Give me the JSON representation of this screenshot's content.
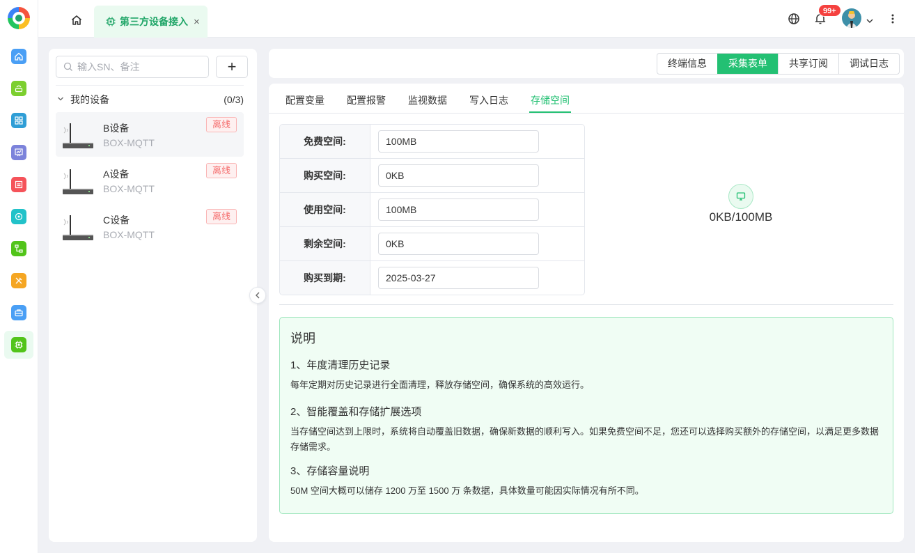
{
  "header": {
    "tab_label": "第三方设备接入",
    "tab_close": "×",
    "notification_count": "99+"
  },
  "sidebar": {
    "items": [
      {
        "icon": "home-icon",
        "color": "#4a9ff5"
      },
      {
        "icon": "cloud-device-icon",
        "color": "#7ccf2f"
      },
      {
        "icon": "apps-grid-icon",
        "color": "#2f9ed6"
      },
      {
        "icon": "chart-board-icon",
        "color": "#7c83db"
      },
      {
        "icon": "report-icon",
        "color": "#f5535a"
      },
      {
        "icon": "connect-icon",
        "color": "#22c2c9"
      },
      {
        "icon": "flow-icon",
        "color": "#52c41a"
      },
      {
        "icon": "tools-icon",
        "color": "#f5a623"
      },
      {
        "icon": "briefcase-icon",
        "color": "#4a9ff5"
      },
      {
        "icon": "chip-icon",
        "color": "#52c41a",
        "active": true
      }
    ]
  },
  "devices": {
    "search_placeholder": "输入SN、备注",
    "add_label": "+",
    "group_name": "我的设备",
    "group_count": "(0/3)",
    "items": [
      {
        "name": "B设备",
        "type": "BOX-MQTT",
        "status": "离线"
      },
      {
        "name": "A设备",
        "type": "BOX-MQTT",
        "status": "离线"
      },
      {
        "name": "C设备",
        "type": "BOX-MQTT",
        "status": "离线"
      }
    ]
  },
  "top_tabs": [
    "终端信息",
    "采集表单",
    "共享订阅",
    "调试日志"
  ],
  "sub_tabs": [
    "配置变量",
    "配置报警",
    "监视数据",
    "写入日志",
    "存储空间"
  ],
  "storage": {
    "rows": [
      {
        "label": "免费空间:",
        "value": "100MB"
      },
      {
        "label": "购买空间:",
        "value": "0KB"
      },
      {
        "label": "使用空间:",
        "value": "100MB"
      },
      {
        "label": "剩余空间:",
        "value": "0KB"
      },
      {
        "label": "购买到期:",
        "value": "2025-03-27"
      }
    ],
    "usage": "0KB/100MB"
  },
  "notice": {
    "title": "说明",
    "h1": "1、年度清理历史记录",
    "p1": "每年定期对历史记录进行全面清理，释放存储空间，确保系统的高效运行。",
    "h2": "2、智能覆盖和存储扩展选项",
    "p2": "当存储空间达到上限时，系统将自动覆盖旧数据，确保新数据的顺利写入。如果免费空间不足，您还可以选择购买额外的存储空间，以满足更多数据存储需求。",
    "h3": "3、存储容量说明",
    "p3": "50M 空间大概可以储存 1200 万至 1500 万 条数据，具体数量可能因实际情况有所不同。"
  }
}
